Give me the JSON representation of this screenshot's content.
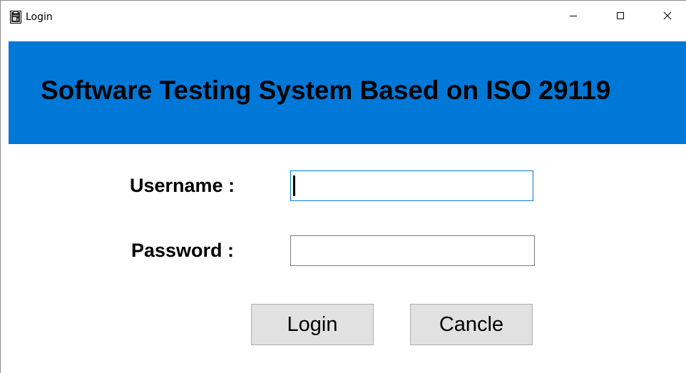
{
  "window": {
    "title": "Login",
    "icon": "app-icon",
    "controls": {
      "minimize_icon": "minimize-icon",
      "maximize_icon": "maximize-icon",
      "close_icon": "close-icon"
    }
  },
  "banner": {
    "title": "Software Testing System Based on ISO 29119",
    "background_color": "#0078d7"
  },
  "form": {
    "username_label": "Username :",
    "username_value": "",
    "password_label": "Password :",
    "password_value": ""
  },
  "buttons": {
    "login_label": "Login",
    "cancel_label": "Cancle"
  }
}
